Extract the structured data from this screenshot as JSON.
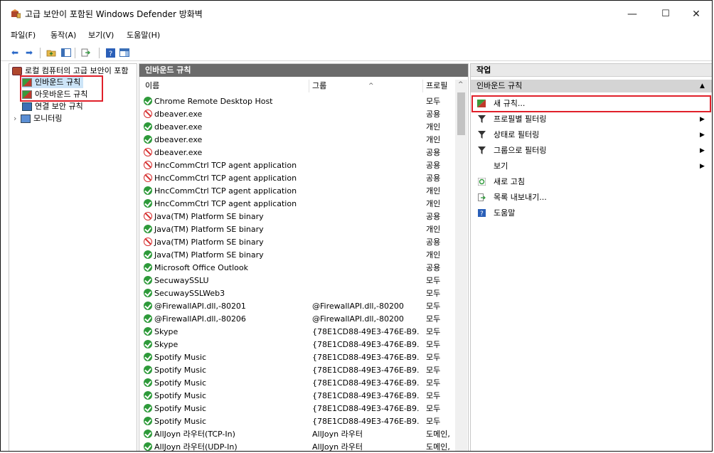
{
  "window": {
    "title": "고급 보안이 포함된 Windows Defender 방화벽",
    "minimize": "—",
    "maximize": "☐",
    "close": "✕"
  },
  "menu": [
    "파일(F)",
    "동작(A)",
    "보기(V)",
    "도움말(H)"
  ],
  "tree": {
    "root": "로컬 컴퓨터의 고급 보안이 포함",
    "inbound": "인바운드 규칙",
    "outbound": "아웃바운드 규칙",
    "connection": "연결 보안 규칙",
    "monitoring": "모니터링"
  },
  "middle": {
    "title": "인바운드 규칙",
    "columns": {
      "name": "이름",
      "group": "그룹",
      "profile": "프로필"
    },
    "rows": [
      {
        "status": "allow",
        "name": "Chrome Remote Desktop Host",
        "group": "",
        "profile": "모두"
      },
      {
        "status": "block",
        "name": "dbeaver.exe",
        "group": "",
        "profile": "공용"
      },
      {
        "status": "allow",
        "name": "dbeaver.exe",
        "group": "",
        "profile": "개인"
      },
      {
        "status": "allow",
        "name": "dbeaver.exe",
        "group": "",
        "profile": "개인"
      },
      {
        "status": "block",
        "name": "dbeaver.exe",
        "group": "",
        "profile": "공용"
      },
      {
        "status": "block",
        "name": "HncCommCtrl TCP agent application",
        "group": "",
        "profile": "공용"
      },
      {
        "status": "block",
        "name": "HncCommCtrl TCP agent application",
        "group": "",
        "profile": "공용"
      },
      {
        "status": "allow",
        "name": "HncCommCtrl TCP agent application",
        "group": "",
        "profile": "개인"
      },
      {
        "status": "allow",
        "name": "HncCommCtrl TCP agent application",
        "group": "",
        "profile": "개인"
      },
      {
        "status": "block",
        "name": "Java(TM) Platform SE binary",
        "group": "",
        "profile": "공용"
      },
      {
        "status": "allow",
        "name": "Java(TM) Platform SE binary",
        "group": "",
        "profile": "개인"
      },
      {
        "status": "block",
        "name": "Java(TM) Platform SE binary",
        "group": "",
        "profile": "공용"
      },
      {
        "status": "allow",
        "name": "Java(TM) Platform SE binary",
        "group": "",
        "profile": "개인"
      },
      {
        "status": "allow",
        "name": "Microsoft Office Outlook",
        "group": "",
        "profile": "공용"
      },
      {
        "status": "allow",
        "name": "SecuwaySSLU",
        "group": "",
        "profile": "모두"
      },
      {
        "status": "allow",
        "name": "SecuwaySSLWeb3",
        "group": "",
        "profile": "모두"
      },
      {
        "status": "allow",
        "name": "@FirewallAPI.dll,-80201",
        "group": "@FirewallAPI.dll,-80200",
        "profile": "모두"
      },
      {
        "status": "allow",
        "name": "@FirewallAPI.dll,-80206",
        "group": "@FirewallAPI.dll,-80200",
        "profile": "모두"
      },
      {
        "status": "allow",
        "name": "Skype",
        "group": "{78E1CD88-49E3-476E-B9...",
        "profile": "모두"
      },
      {
        "status": "allow",
        "name": "Skype",
        "group": "{78E1CD88-49E3-476E-B9...",
        "profile": "모두"
      },
      {
        "status": "allow",
        "name": "Spotify Music",
        "group": "{78E1CD88-49E3-476E-B9...",
        "profile": "모두"
      },
      {
        "status": "allow",
        "name": "Spotify Music",
        "group": "{78E1CD88-49E3-476E-B9...",
        "profile": "모두"
      },
      {
        "status": "allow",
        "name": "Spotify Music",
        "group": "{78E1CD88-49E3-476E-B9...",
        "profile": "모두"
      },
      {
        "status": "allow",
        "name": "Spotify Music",
        "group": "{78E1CD88-49E3-476E-B9...",
        "profile": "모두"
      },
      {
        "status": "allow",
        "name": "Spotify Music",
        "group": "{78E1CD88-49E3-476E-B9...",
        "profile": "모두"
      },
      {
        "status": "allow",
        "name": "Spotify Music",
        "group": "{78E1CD88-49E3-476E-B9...",
        "profile": "모두"
      },
      {
        "status": "allow",
        "name": "AllJoyn 라우터(TCP-In)",
        "group": "AllJoyn 라우터",
        "profile": "도메인,..."
      },
      {
        "status": "allow",
        "name": "AllJoyn 라우터(UDP-In)",
        "group": "AllJoyn 라우터",
        "profile": "도메인,..."
      }
    ]
  },
  "actions": {
    "title": "작업",
    "section": "인바운드 규칙",
    "items": [
      {
        "label": "새 규칙...",
        "icon": "new-rule-icon",
        "arrow": false
      },
      {
        "label": "프로필별 필터링",
        "icon": "filter-icon",
        "arrow": true
      },
      {
        "label": "상태로 필터링",
        "icon": "filter-icon",
        "arrow": true
      },
      {
        "label": "그룹으로 필터링",
        "icon": "filter-icon",
        "arrow": true
      },
      {
        "label": "보기",
        "icon": "",
        "arrow": true
      },
      {
        "label": "새로 고침",
        "icon": "refresh-icon",
        "arrow": false
      },
      {
        "label": "목록 내보내기...",
        "icon": "export-icon",
        "arrow": false
      },
      {
        "label": "도움말",
        "icon": "help-icon",
        "arrow": false
      }
    ]
  },
  "colors": {
    "highlight": "#e0202a",
    "panel_header": "#6b6b6b",
    "allow": "#2e9a3a",
    "block": "#d63030"
  }
}
